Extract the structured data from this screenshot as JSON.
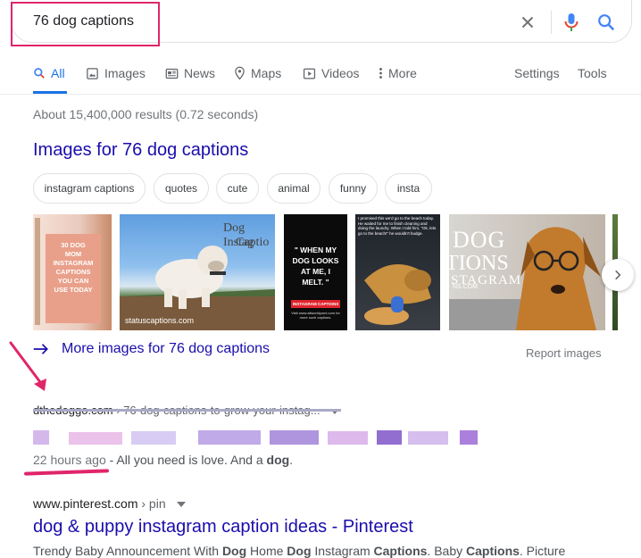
{
  "search": {
    "query": "76 dog captions"
  },
  "tabs": [
    {
      "label": "All",
      "icon": "search-icon",
      "active": true
    },
    {
      "label": "Images",
      "icon": "image-icon"
    },
    {
      "label": "News",
      "icon": "news-icon"
    },
    {
      "label": "Maps",
      "icon": "map-pin-icon"
    },
    {
      "label": "Videos",
      "icon": "video-icon"
    },
    {
      "label": "More",
      "icon": "more-vert-icon"
    }
  ],
  "tools": {
    "settings": "Settings",
    "tools": "Tools"
  },
  "result_stats": "About 15,400,000 results (0.72 seconds)",
  "images_section": {
    "heading": "Images for 76 dog captions",
    "chips": [
      "instagram captions",
      "quotes",
      "cute",
      "animal",
      "funny",
      "insta"
    ],
    "thumbs": [
      {
        "lines": [
          "30 DOG",
          "MOM",
          "INSTAGRAM",
          "CAPTIONS",
          "YOU CAN",
          "USE TODAY"
        ]
      },
      {
        "overlay_1": "Dog Instag",
        "overlay_2": "Captio",
        "footer": "statuscaptions.com"
      },
      {
        "quote": "\" WHEN MY DOG LOOKS AT ME, I MELT. \"",
        "badge": "INSTAGRAM CAPTIONS",
        "footer": "Visit www.allworldyomi.com for more such captions."
      },
      {
        "top_text": "I promised this we'd go to the beach today. He waited for me to finish cleaning and doing the laundry. When I told him, \"Ok, lets go to the beach!\" he wouldn't budge."
      },
      {
        "overlay_1": "DOG",
        "overlay_2": "TIONS",
        "overlay_3": "STAGRAM",
        "overlay_4": "NS.COM"
      }
    ],
    "more_link": "More images for 76 dog captions",
    "report": "Report images"
  },
  "results": [
    {
      "site": "dthedoggo.com",
      "crumb": " › 76-dog-captions-to-grow-your-instag...",
      "date": "22 hours ago",
      "snippet_pre": " - All you need is love. And a ",
      "snippet_bold": "dog",
      "snippet_post": "."
    },
    {
      "site": "www.pinterest.com",
      "crumb": " › pin",
      "title": "dog & puppy instagram caption ideas - Pinterest",
      "snippet": [
        {
          "t": "Trendy Baby Announcement With "
        },
        {
          "t": "Dog",
          "b": true
        },
        {
          "t": " Home "
        },
        {
          "t": "Dog",
          "b": true
        },
        {
          "t": " Instagram "
        },
        {
          "t": "Captions",
          "b": true
        },
        {
          "t": ". Baby "
        },
        {
          "t": "Captions",
          "b": true
        },
        {
          "t": ". Picture"
        }
      ]
    }
  ],
  "colors": {
    "link": "#1a0dab",
    "active_tab": "#1a73e8",
    "annotation": "#e0256a"
  }
}
